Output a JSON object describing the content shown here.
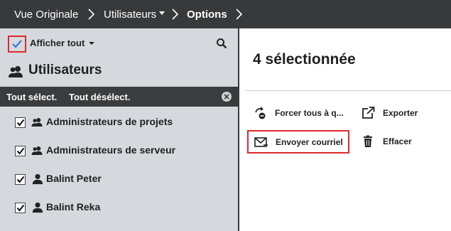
{
  "breadcrumb": {
    "items": [
      {
        "label": "Vue Originale"
      },
      {
        "label": "Utilisateurs"
      },
      {
        "label": "Options"
      }
    ]
  },
  "filter": {
    "show_all_label": "Afficher tout"
  },
  "users_panel": {
    "title": "Utilisateurs",
    "select_all_label": "Tout sélect.",
    "deselect_all_label": "Tout désélect."
  },
  "list": {
    "items": [
      {
        "label": "Administrateurs de projets",
        "type": "group",
        "checked": true
      },
      {
        "label": "Administrateurs de serveur",
        "type": "group",
        "checked": true
      },
      {
        "label": "Balint Peter",
        "type": "user",
        "checked": true
      },
      {
        "label": "Balint Reka",
        "type": "user",
        "checked": true
      }
    ]
  },
  "selection": {
    "title": "4 sélectionnée"
  },
  "actions": {
    "force_label": "Forcer tous à q...",
    "export_label": "Exporter",
    "email_label": "Envoyer courriel",
    "delete_label": "Effacer"
  },
  "colors": {
    "topbar": "#38393b",
    "panel": "#d5d9dd",
    "highlight": "#e0282e",
    "check_accent": "#3a7bd5"
  }
}
